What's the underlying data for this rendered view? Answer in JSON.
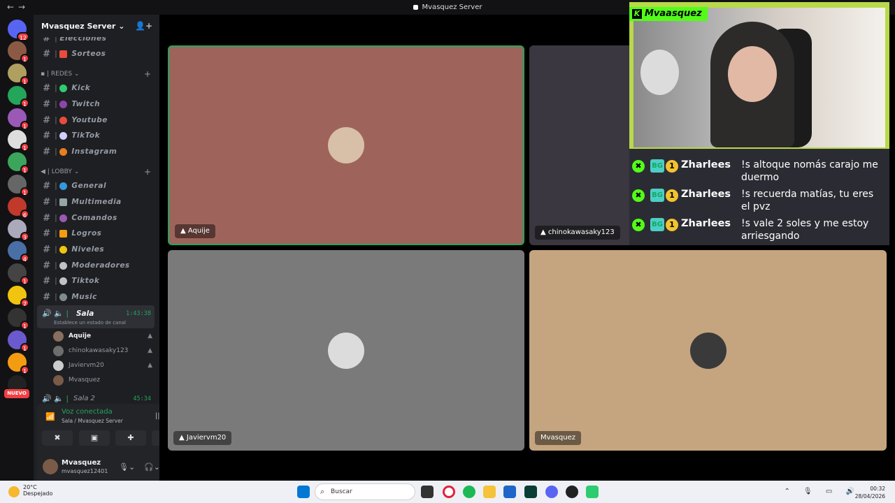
{
  "window": {
    "title": "Mvasquez Server"
  },
  "guild_badges": [
    "12",
    "1",
    "1",
    "1",
    "1",
    "1",
    "1",
    "1",
    "6",
    "3",
    "4",
    "1",
    "7",
    "1",
    "1",
    "1",
    "1"
  ],
  "guild_new_label": "NUEVO",
  "server": {
    "name": "Mvasquez Server"
  },
  "channels": {
    "partial_top": "Elecciones",
    "sorteos": "Sorteos",
    "cat_redes": "REDES",
    "redes": [
      {
        "label": "Kick",
        "color": "#2ecc71"
      },
      {
        "label": "Twitch",
        "color": "#8e44ad"
      },
      {
        "label": "Youtube",
        "color": "#e74c3c"
      },
      {
        "label": "TikTok",
        "color": "#d0d0ff"
      },
      {
        "label": "Instagram",
        "color": "#e67e22"
      }
    ],
    "cat_lobby": "LOBBY",
    "lobby": [
      {
        "label": "General",
        "color": "#3498db"
      },
      {
        "label": "Multimedia",
        "color": "#95a5a6"
      },
      {
        "label": "Comandos",
        "color": "#9b59b6"
      },
      {
        "label": "Logros",
        "color": "#f39c12"
      },
      {
        "label": "Niveles",
        "color": "#f1c40f"
      },
      {
        "label": "Moderadores",
        "color": "#bdc3c7"
      },
      {
        "label": "Tiktok",
        "color": "#bdc3c7"
      },
      {
        "label": "Music",
        "color": "#7f8c8d"
      }
    ],
    "voice": {
      "name": "Sala",
      "time": "1:43:38",
      "status": "Establece un estado de canal"
    },
    "voice_members": [
      "Aquije",
      "chinokawasaky123",
      "Javiervm20",
      "Mvasquez"
    ],
    "voice2": {
      "name": "Sala 2",
      "time": "45:34"
    }
  },
  "panel": {
    "connected": "Voz conectada",
    "channel_path": "Sala / Mvasquez Server",
    "user_name": "Mvasquez",
    "user_tag": "mvasquez12401"
  },
  "tiles": [
    {
      "name": "Aquije",
      "bg": "#9e645c"
    },
    {
      "name": "chinokawasaky123",
      "bg": "#3a3740"
    },
    {
      "name": "Javiervm20",
      "bg": "#7a7a7a"
    },
    {
      "name": "Mvasquez",
      "bg": "#c4a57f"
    }
  ],
  "stream": {
    "streamer": "Mvaasquez",
    "chat": [
      {
        "user": "Zharlees",
        "text": "!s altoque nomás carajo me duermo"
      },
      {
        "user": "Zharlees",
        "text": "!s recuerda matías, tu eres el pvz"
      },
      {
        "user": "Zharlees",
        "text": "!s vale 2 soles y me estoy arriesgando"
      }
    ],
    "badge_text": "BG",
    "sub_badge": "1"
  },
  "taskbar": {
    "temp": "20°C",
    "weather": "Despejado",
    "search_placeholder": "Buscar",
    "time": "00:32",
    "date": "28/04/2026"
  }
}
